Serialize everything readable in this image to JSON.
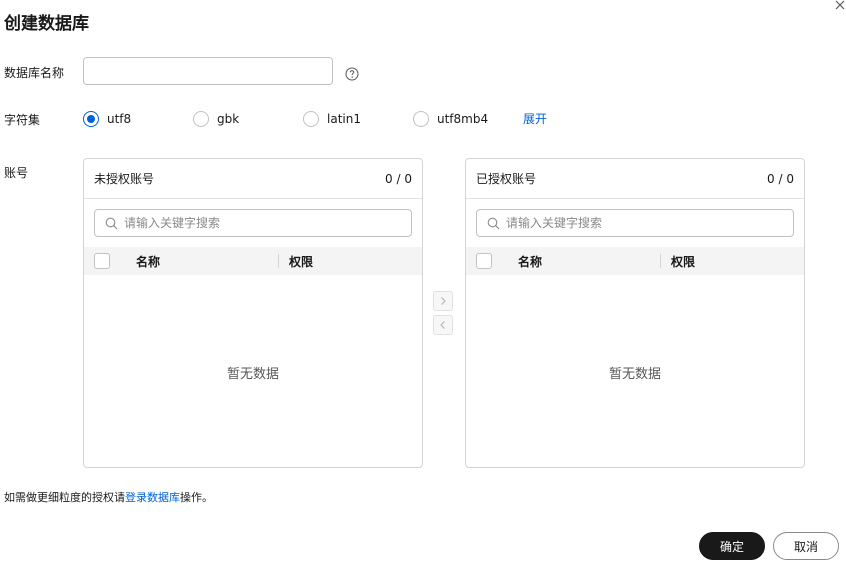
{
  "dialog": {
    "title": "创建数据库"
  },
  "form": {
    "db_name": {
      "label": "数据库名称",
      "value": "",
      "placeholder": ""
    },
    "charset": {
      "label": "字符集",
      "options": [
        "utf8",
        "gbk",
        "latin1",
        "utf8mb4"
      ],
      "selected": "utf8",
      "expand_label": "展开"
    },
    "account": {
      "label": "账号"
    }
  },
  "transfer": {
    "left": {
      "title": "未授权账号",
      "count": "0 / 0",
      "search_placeholder": "请输入关键字搜索",
      "col_name": "名称",
      "col_perm": "权限",
      "empty": "暂无数据"
    },
    "right": {
      "title": "已授权账号",
      "count": "0 / 0",
      "search_placeholder": "请输入关键字搜索",
      "col_name": "名称",
      "col_perm": "权限",
      "empty": "暂无数据"
    }
  },
  "footer": {
    "note_prefix": "如需做更细粒度的授权请",
    "note_link": "登录数据库",
    "note_suffix": "操作。",
    "confirm_label": "确定",
    "cancel_label": "取消"
  },
  "colors": {
    "accent": "#0062d4",
    "primary_button": "#191919"
  }
}
